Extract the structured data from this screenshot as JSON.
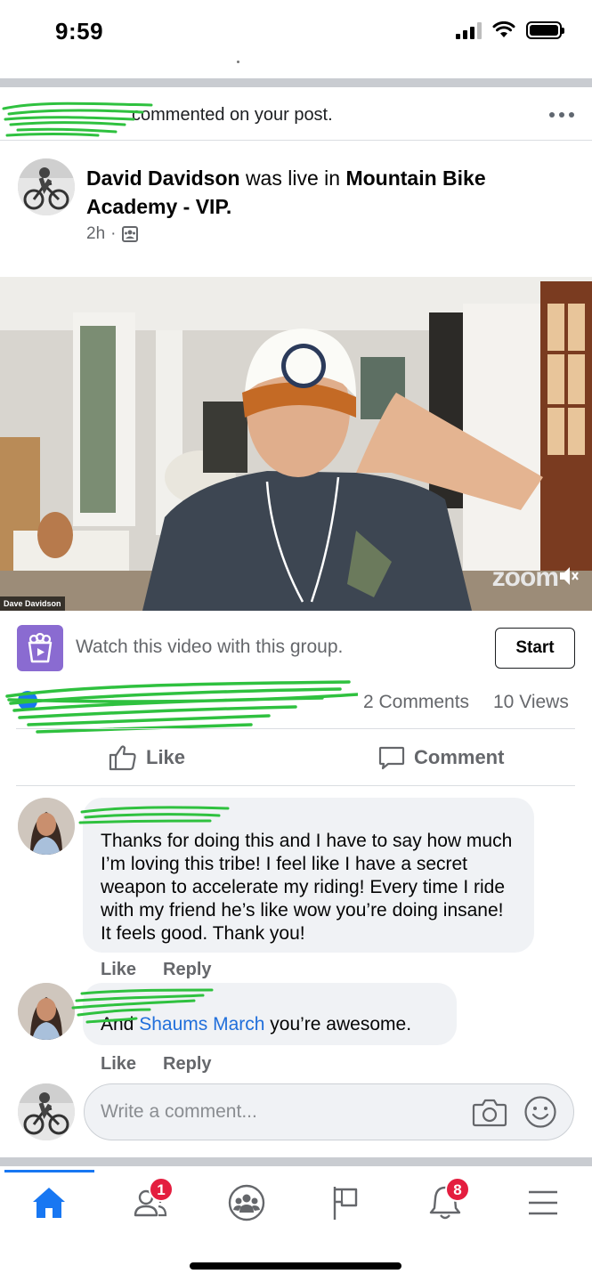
{
  "status_bar": {
    "time": "9:59"
  },
  "notification": {
    "text": "commented on your post.",
    "more_label": "..."
  },
  "post": {
    "author": "David Davidson",
    "verb": "was live in",
    "group": "Mountain Bike Academy - VIP.",
    "time": "2h",
    "separator": "·"
  },
  "video": {
    "speaker_label": "Dave Davidson",
    "provider_logo": "zoom",
    "mute_icon": "speaker-muted-icon"
  },
  "watch_together": {
    "text": "Watch this video with this group.",
    "button": "Start"
  },
  "summary": {
    "comments": "2 Comments",
    "views": "10 Views"
  },
  "actions": {
    "like": "Like",
    "comment": "Comment"
  },
  "comments": [
    {
      "body": "Thanks for doing this and I have to say how much I’m loving this tribe! I feel like I have a secret weapon to accelerate my riding! Every time I ride with my friend he’s like wow you’re doing insane! It feels good. Thank you!",
      "like": "Like",
      "reply": "Reply"
    },
    {
      "body_prefix": "And",
      "mention": "Shaums March",
      "body_suffix": "you’re awesome.",
      "like": "Like",
      "reply": "Reply"
    }
  ],
  "composer": {
    "placeholder": "Write a comment..."
  },
  "tab_bar": {
    "friends_badge": "1",
    "notifications_badge": "8"
  },
  "colors": {
    "accent": "#1877f2",
    "badge": "#e41e3f",
    "mention": "#216fdb",
    "redaction": "#2fc13f"
  }
}
